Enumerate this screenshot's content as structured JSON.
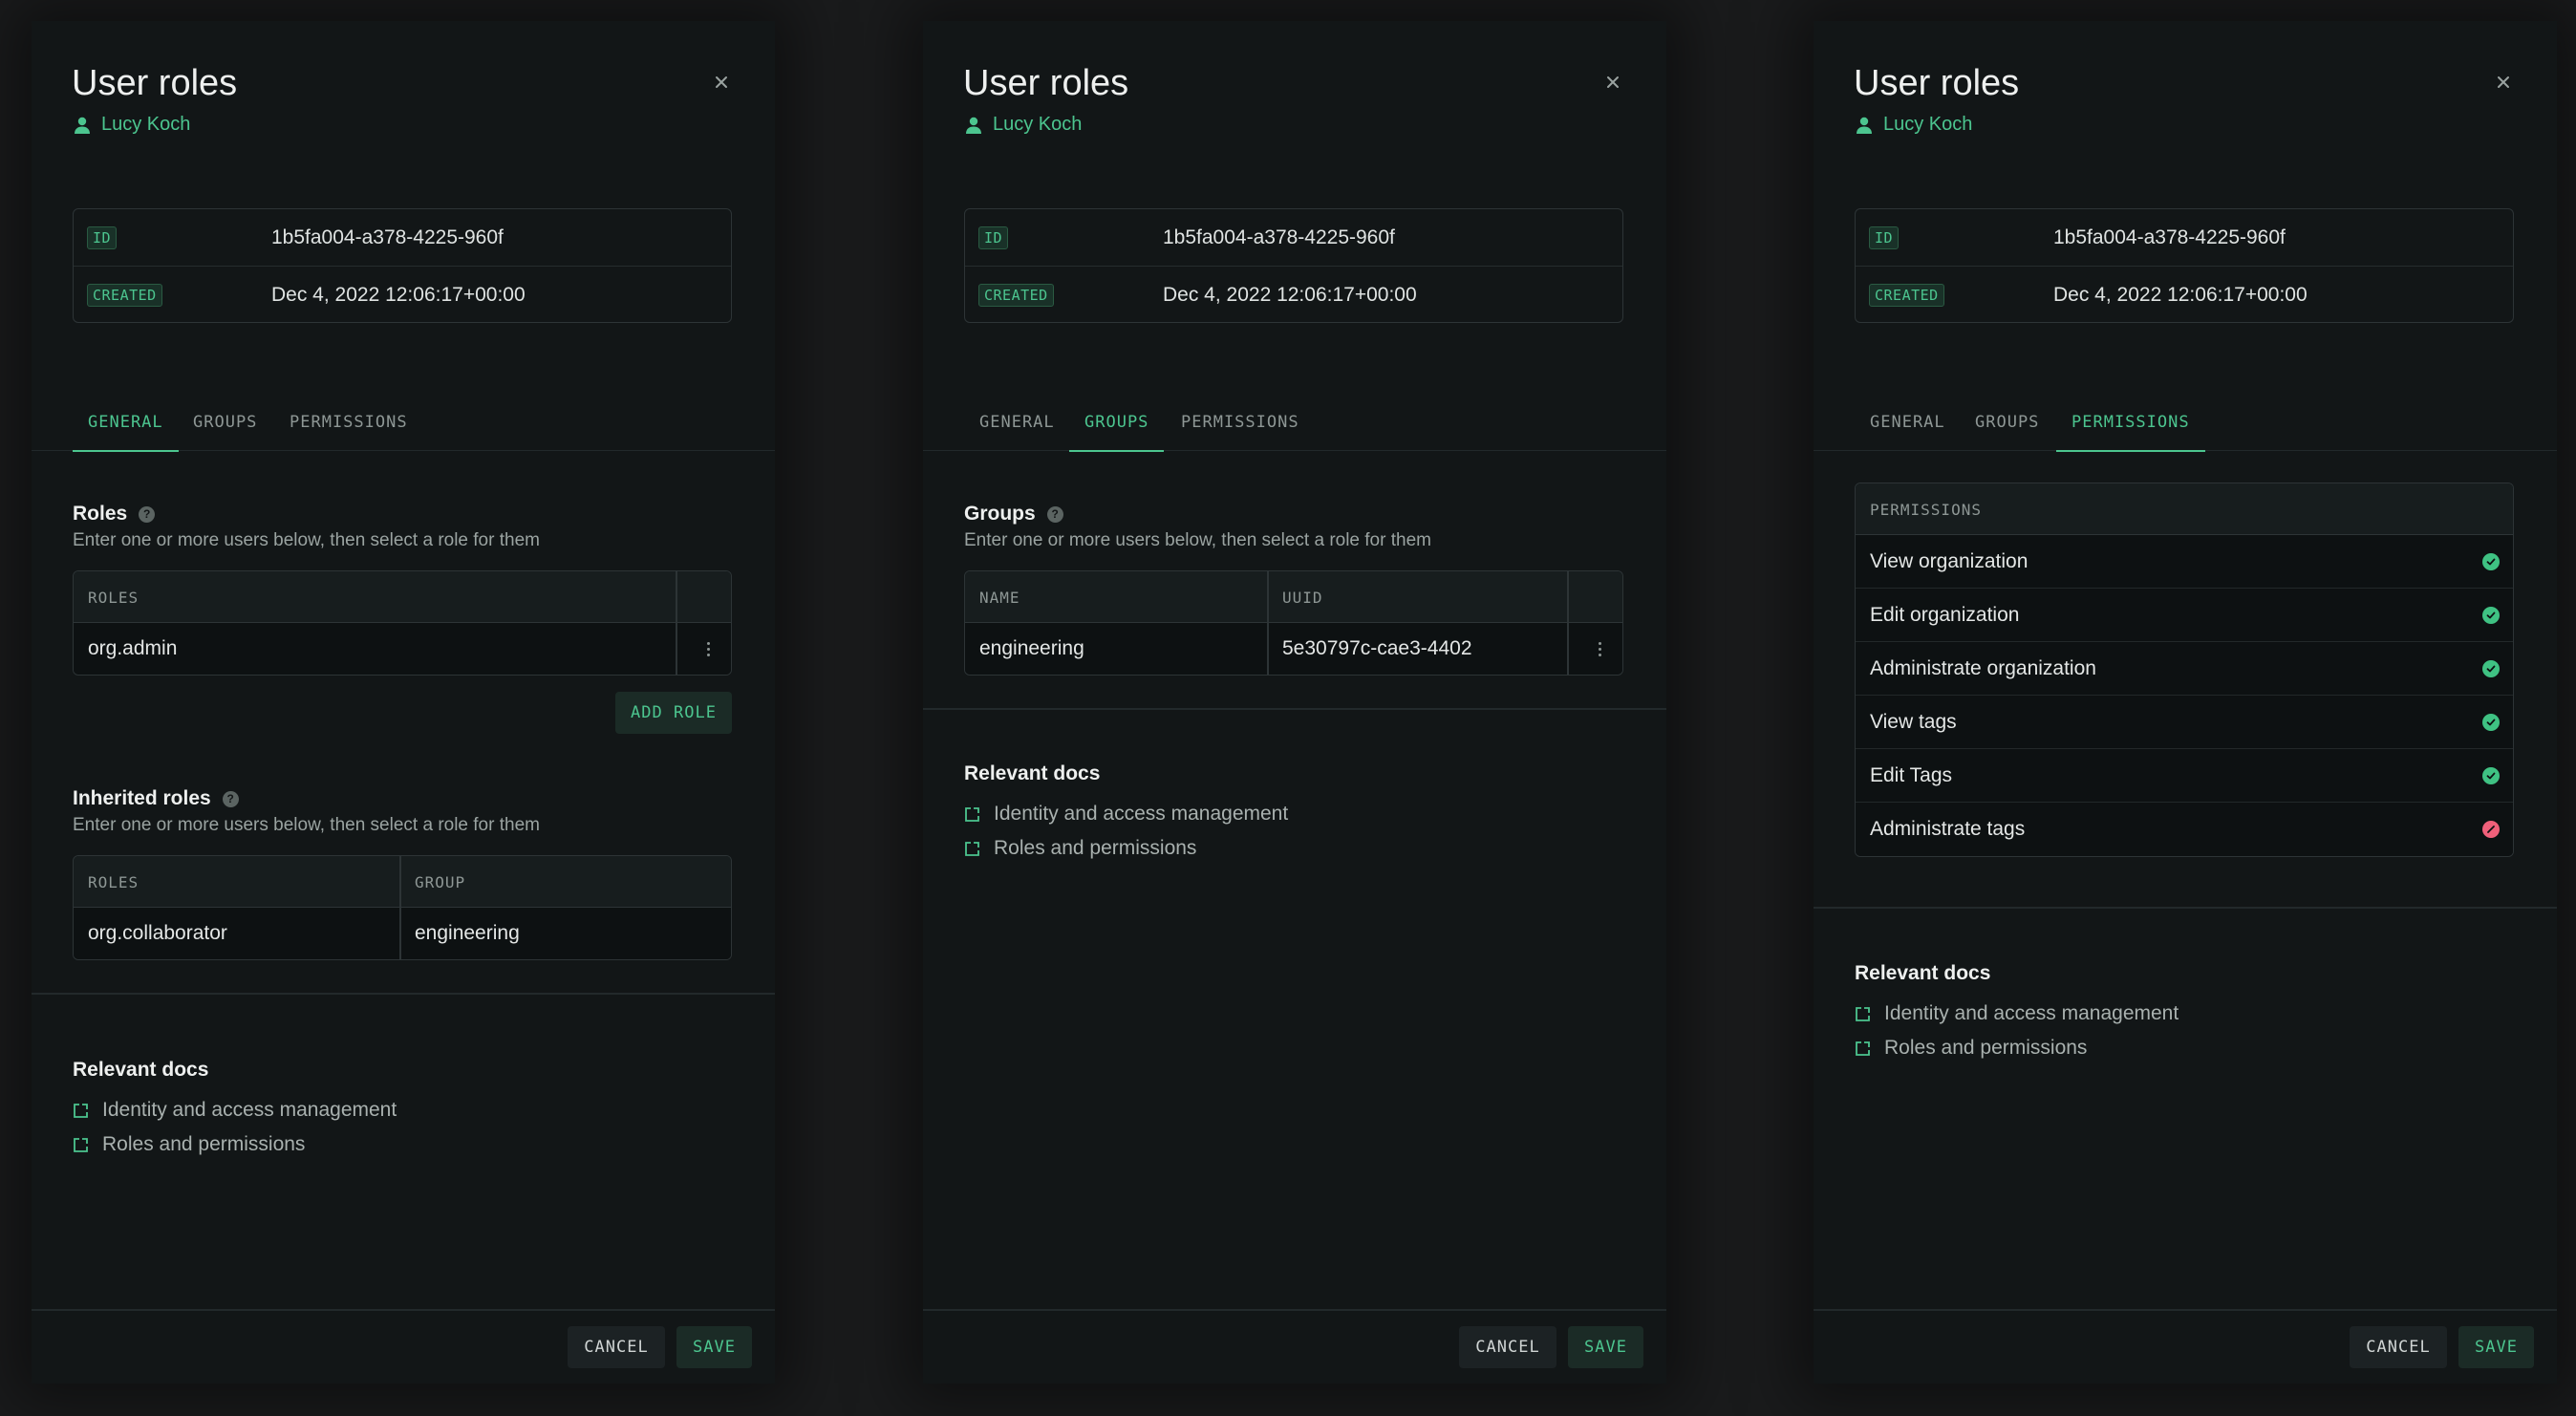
{
  "colors": {
    "accent": "#4cc58f",
    "danger": "#f0607a",
    "panel_bg": "#121617",
    "page_bg": "#1a1b1c"
  },
  "panels": [
    {
      "title": "User roles",
      "user": "Lucy Koch",
      "meta": {
        "id_label": "ID",
        "id_value": "1b5fa004-a378-4225-960f",
        "created_label": "CREATED",
        "created_value": "Dec 4, 2022 12:06:17+00:00"
      },
      "tabs": [
        "GENERAL",
        "GROUPS",
        "PERMISSIONS"
      ],
      "active_tab": "GENERAL",
      "roles": {
        "title": "Roles",
        "subtitle": "Enter one or more users below, then select a role for them",
        "header": "ROLES",
        "rows": [
          "org.admin"
        ],
        "add_label": "ADD ROLE"
      },
      "inherited": {
        "title": "Inherited roles",
        "subtitle": "Enter one or more users below, then select a role for them",
        "headers": [
          "ROLES",
          "GROUP"
        ],
        "rows": [
          [
            "org.collaborator",
            "engineering"
          ]
        ]
      },
      "docs": {
        "title": "Relevant docs",
        "links": [
          "Identity and access management",
          "Roles and permissions"
        ]
      },
      "cancel_label": "CANCEL",
      "save_label": "SAVE"
    },
    {
      "title": "User roles",
      "user": "Lucy Koch",
      "meta": {
        "id_label": "ID",
        "id_value": "1b5fa004-a378-4225-960f",
        "created_label": "CREATED",
        "created_value": "Dec 4, 2022 12:06:17+00:00"
      },
      "tabs": [
        "GENERAL",
        "GROUPS",
        "PERMISSIONS"
      ],
      "active_tab": "GROUPS",
      "groups": {
        "title": "Groups",
        "subtitle": "Enter one or more users below, then select a role for them",
        "headers": [
          "NAME",
          "UUID"
        ],
        "rows": [
          [
            "engineering",
            "5e30797c-cae3-4402"
          ]
        ]
      },
      "docs": {
        "title": "Relevant docs",
        "links": [
          "Identity and access management",
          "Roles and permissions"
        ]
      },
      "cancel_label": "CANCEL",
      "save_label": "SAVE"
    },
    {
      "title": "User roles",
      "user": "Lucy Koch",
      "meta": {
        "id_label": "ID",
        "id_value": "1b5fa004-a378-4225-960f",
        "created_label": "CREATED",
        "created_value": "Dec 4, 2022 12:06:17+00:00"
      },
      "tabs": [
        "GENERAL",
        "GROUPS",
        "PERMISSIONS"
      ],
      "active_tab": "PERMISSIONS",
      "permissions": {
        "header": "PERMISSIONS",
        "rows": [
          {
            "label": "View organization",
            "granted": true
          },
          {
            "label": "Edit organization",
            "granted": true
          },
          {
            "label": "Administrate organization",
            "granted": true
          },
          {
            "label": "View tags",
            "granted": true
          },
          {
            "label": "Edit Tags",
            "granted": true
          },
          {
            "label": "Administrate tags",
            "granted": false
          }
        ]
      },
      "docs": {
        "title": "Relevant docs",
        "links": [
          "Identity and access management",
          "Roles and permissions"
        ]
      },
      "cancel_label": "CANCEL",
      "save_label": "SAVE"
    }
  ]
}
